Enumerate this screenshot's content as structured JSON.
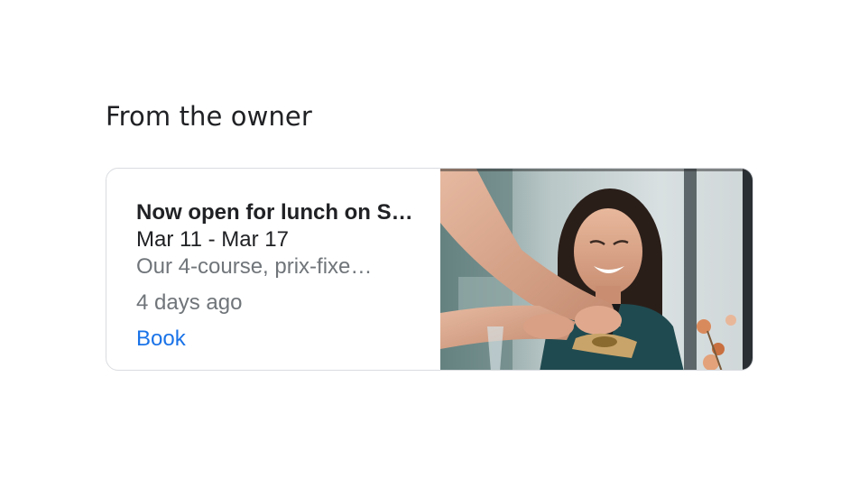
{
  "section": {
    "title": "From the owner"
  },
  "post": {
    "title": "Now open for lunch on S…",
    "dates": "Mar 11 - Mar 17",
    "snippet": "Our 4-course, prix-fixe…",
    "time_ago": "4 days ago",
    "action_label": "Book"
  },
  "colors": {
    "title_text": "#202124",
    "secondary_text": "#70757a",
    "link": "#1a73e8",
    "card_border": "#dadce0"
  },
  "image": {
    "subject": "smiling woman being served food at restaurant table"
  }
}
